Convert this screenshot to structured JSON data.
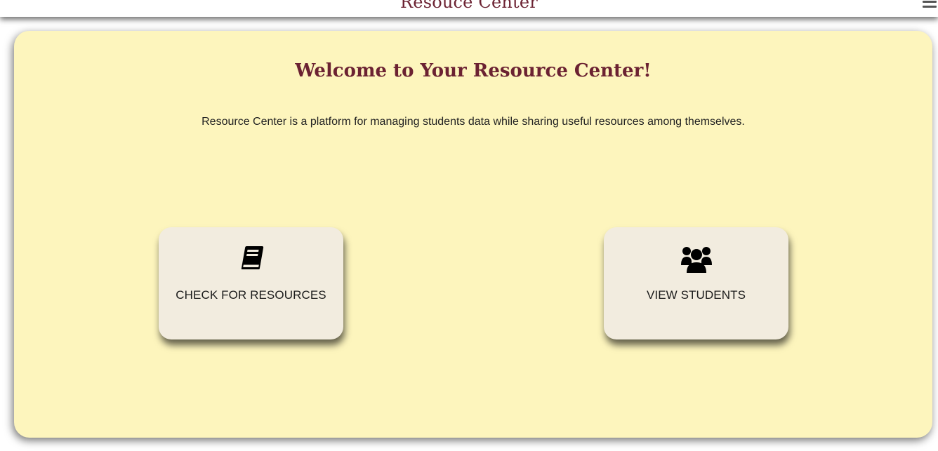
{
  "header": {
    "brand": "Resouce Center",
    "menu_icon": "hamburger-menu-icon"
  },
  "main": {
    "title": "Welcome to Your Resource Center!",
    "description": "Resource Center is a platform for managing students data while sharing useful resources among themselves.",
    "actions": [
      {
        "label": "CHECK FOR RESOURCES",
        "icon": "book-icon"
      },
      {
        "label": "VIEW STUDENTS",
        "icon": "users-icon"
      }
    ]
  },
  "colors": {
    "accent": "#6b2232",
    "card_background": "#fdf5bd",
    "action_background": "#f2ecdf",
    "text": "#222222"
  }
}
